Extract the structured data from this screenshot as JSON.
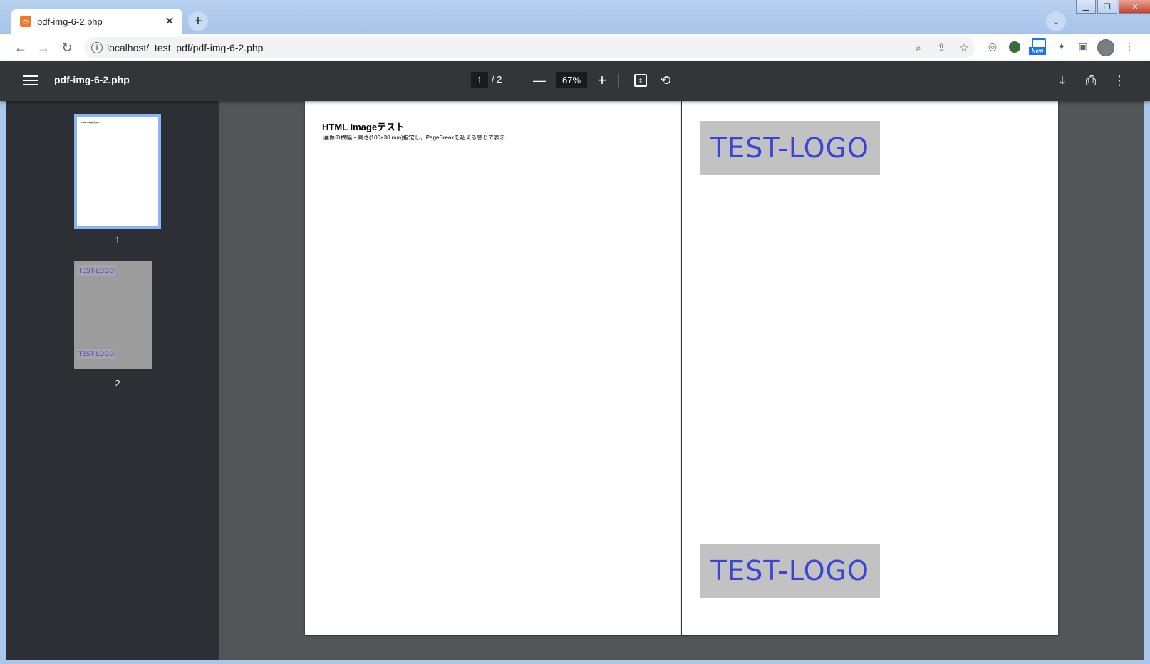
{
  "browser": {
    "tab": {
      "title": "pdf-img-6-2.php"
    },
    "url": "localhost/_test_pdf/pdf-img-6-2.php",
    "extension_badge": "New"
  },
  "pdf_toolbar": {
    "title": "pdf-img-6-2.php",
    "current_page": "1",
    "page_total": "/  2",
    "zoom": "67%"
  },
  "sidebar": {
    "thumbnails": [
      {
        "label": "1",
        "preview_title": "HTML Imageテスト"
      },
      {
        "label": "2",
        "logo_top": "TEST-LOGO",
        "logo_bottom": "TEST-LOGO"
      }
    ]
  },
  "document": {
    "page1": {
      "title": "HTML Imageテスト",
      "subtitle": "画像の横幅・高さ(100×30 mm)指定し，PageBreakを超える感じで表示"
    },
    "page2": {
      "logo_top": "TEST-LOGO",
      "logo_bottom": "TEST-LOGO"
    }
  },
  "colors": {
    "pdf_toolbar": "#323639",
    "sidebar": "#2c3034",
    "viewer_bg": "#525659",
    "thumb_selected": "#8ab4f8",
    "logo_text": "#3a45d6",
    "logo_bg": "#c2c2c2"
  },
  "icons": [
    "menu-icon",
    "zoom-out-icon",
    "zoom-in-icon",
    "fit-page-icon",
    "rotate-icon",
    "download-icon",
    "print-icon",
    "more-icon"
  ]
}
